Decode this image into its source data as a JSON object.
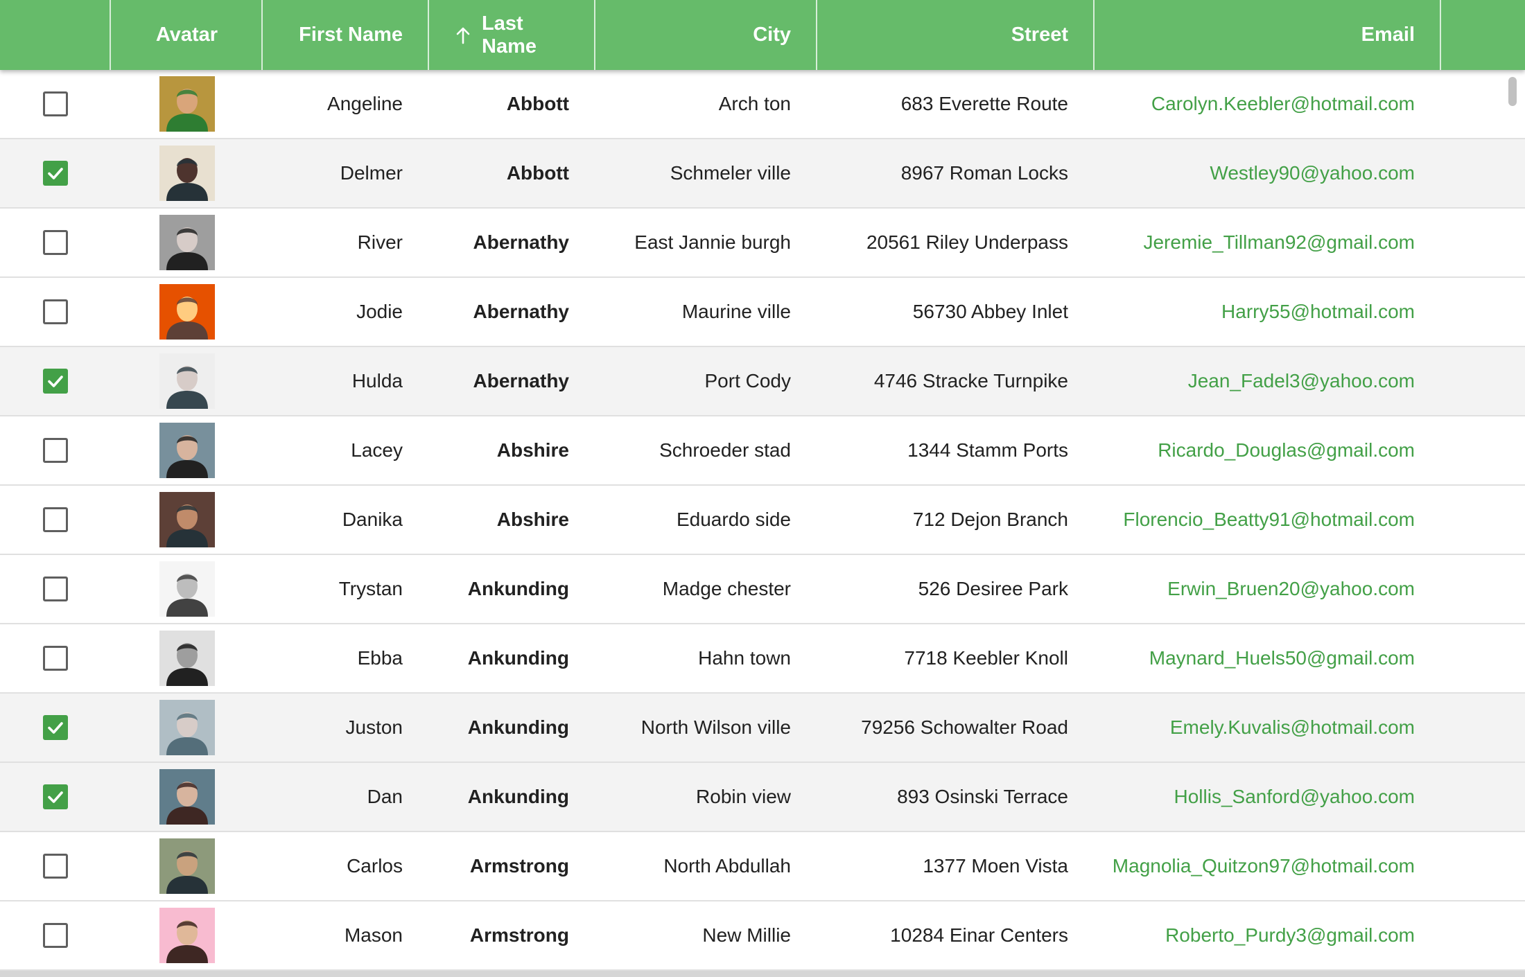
{
  "table": {
    "columns": {
      "avatar": "Avatar",
      "first_name": "First Name",
      "last_name": "Last Name",
      "city": "City",
      "street": "Street",
      "email": "Email"
    },
    "sort": {
      "column": "last_name",
      "direction": "ascending",
      "icon": "arrow-up-icon"
    },
    "colors": {
      "header": "#66bb6a",
      "accent": "#43a047",
      "selected_row": "#f3f3f3"
    },
    "rows": [
      {
        "selected": false,
        "first": "Angeline",
        "last": "Abbott",
        "city": "Arch ton",
        "street": "683 Everette Route",
        "email": "Carolyn.Keebler@hotmail.com",
        "avatar_colors": [
          "#b8963e",
          "#d9a57a",
          "#2e7d32"
        ]
      },
      {
        "selected": true,
        "first": "Delmer",
        "last": "Abbott",
        "city": "Schmeler ville",
        "street": "8967 Roman Locks",
        "email": "Westley90@yahoo.com",
        "avatar_colors": [
          "#e8e0d0",
          "#4e342e",
          "#263238"
        ]
      },
      {
        "selected": false,
        "first": "River",
        "last": "Abernathy",
        "city": "East Jannie burgh",
        "street": "20561 Riley Underpass",
        "email": "Jeremie_Tillman92@gmail.com",
        "avatar_colors": [
          "#9e9e9e",
          "#d7ccc8",
          "#212121"
        ]
      },
      {
        "selected": false,
        "first": "Jodie",
        "last": "Abernathy",
        "city": "Maurine ville",
        "street": "56730 Abbey Inlet",
        "email": "Harry55@hotmail.com",
        "avatar_colors": [
          "#e65100",
          "#ffcc80",
          "#5d4037"
        ]
      },
      {
        "selected": true,
        "first": "Hulda",
        "last": "Abernathy",
        "city": "Port Cody",
        "street": "4746 Stracke Turnpike",
        "email": "Jean_Fadel3@yahoo.com",
        "avatar_colors": [
          "#eeeeee",
          "#d7ccc8",
          "#37474f"
        ]
      },
      {
        "selected": false,
        "first": "Lacey",
        "last": "Abshire",
        "city": "Schroeder stad",
        "street": "1344 Stamm Ports",
        "email": "Ricardo_Douglas@gmail.com",
        "avatar_colors": [
          "#78909c",
          "#d7b49e",
          "#212121"
        ]
      },
      {
        "selected": false,
        "first": "Danika",
        "last": "Abshire",
        "city": "Eduardo side",
        "street": "712 Dejon Branch",
        "email": "Florencio_Beatty91@hotmail.com",
        "avatar_colors": [
          "#5d4037",
          "#c08b6a",
          "#263238"
        ]
      },
      {
        "selected": false,
        "first": "Trystan",
        "last": "Ankunding",
        "city": "Madge chester",
        "street": "526 Desiree Park",
        "email": "Erwin_Bruen20@yahoo.com",
        "avatar_colors": [
          "#f5f5f5",
          "#bdbdbd",
          "#424242"
        ]
      },
      {
        "selected": false,
        "first": "Ebba",
        "last": "Ankunding",
        "city": "Hahn town",
        "street": "7718 Keebler Knoll",
        "email": "Maynard_Huels50@gmail.com",
        "avatar_colors": [
          "#e0e0e0",
          "#9e9e9e",
          "#212121"
        ]
      },
      {
        "selected": true,
        "first": "Juston",
        "last": "Ankunding",
        "city": "North Wilson ville",
        "street": "79256 Schowalter Road",
        "email": "Emely.Kuvalis@hotmail.com",
        "avatar_colors": [
          "#b0bec5",
          "#d7ccc8",
          "#546e7a"
        ]
      },
      {
        "selected": true,
        "first": "Dan",
        "last": "Ankunding",
        "city": "Robin view",
        "street": "893 Osinski Terrace",
        "email": "Hollis_Sanford@yahoo.com",
        "avatar_colors": [
          "#607d8b",
          "#d7b49e",
          "#3e2723"
        ]
      },
      {
        "selected": false,
        "first": "Carlos",
        "last": "Armstrong",
        "city": "North Abdullah",
        "street": "1377 Moen Vista",
        "email": "Magnolia_Quitzon97@hotmail.com",
        "avatar_colors": [
          "#8d9a7b",
          "#c9a27e",
          "#263238"
        ]
      },
      {
        "selected": false,
        "first": "Mason",
        "last": "Armstrong",
        "city": "New Millie",
        "street": "10284 Einar Centers",
        "email": "Roberto_Purdy3@gmail.com",
        "avatar_colors": [
          "#f8bbd0",
          "#e0b899",
          "#3e2723"
        ]
      }
    ]
  }
}
